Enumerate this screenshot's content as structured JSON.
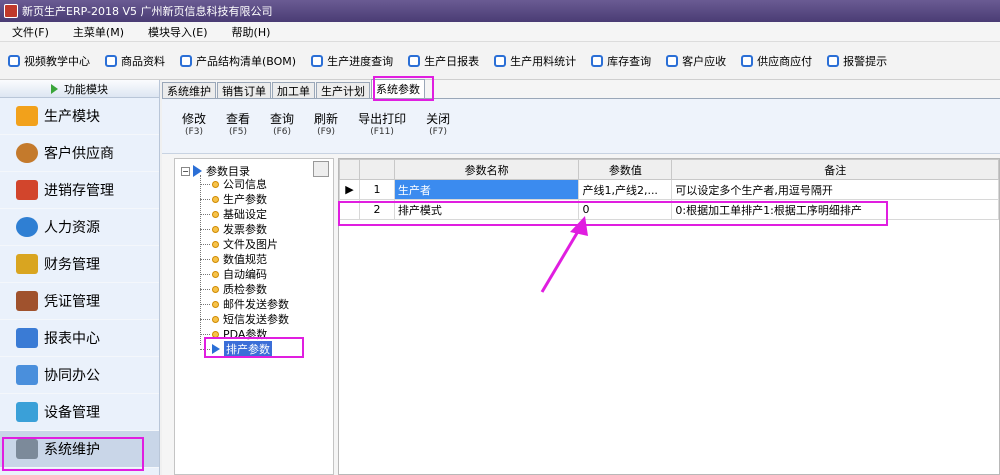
{
  "window": {
    "title": "新页生产ERP-2018 V5 广州新页信息科技有限公司"
  },
  "menu": [
    "文件(F)",
    "主菜单(M)",
    "模块导入(E)",
    "帮助(H)"
  ],
  "quickbar": [
    "视频教学中心",
    "商品资料",
    "产品结构清单(BOM)",
    "生产进度查询",
    "生产日报表",
    "生产用料统计",
    "库存查询",
    "客户应收",
    "供应商应付",
    "报警提示"
  ],
  "sidebar": {
    "header": "功能模块",
    "items": [
      {
        "label": "生产模块",
        "color": "#f2a11b"
      },
      {
        "label": "客户供应商",
        "color": "#c47a2c"
      },
      {
        "label": "进销存管理",
        "color": "#d2452c"
      },
      {
        "label": "人力资源",
        "color": "#2f7fd3"
      },
      {
        "label": "财务管理",
        "color": "#d9a520"
      },
      {
        "label": "凭证管理",
        "color": "#a0522d"
      },
      {
        "label": "报表中心",
        "color": "#3a7bd5"
      },
      {
        "label": "协同办公",
        "color": "#4a8fdc"
      },
      {
        "label": "设备管理",
        "color": "#3aa0d8"
      },
      {
        "label": "系统维护",
        "color": "#7c8a9a"
      }
    ]
  },
  "tabs": [
    "系统维护",
    "销售订单",
    "加工单",
    "生产计划",
    "系统参数"
  ],
  "toolbar": [
    {
      "label": "修改",
      "key": "(F3)"
    },
    {
      "label": "查看",
      "key": "(F5)"
    },
    {
      "label": "查询",
      "key": "(F6)"
    },
    {
      "label": "刷新",
      "key": "(F9)"
    },
    {
      "label": "导出打印",
      "key": "(F11)"
    },
    {
      "label": "关闭",
      "key": "(F7)"
    }
  ],
  "tree": {
    "root": "参数目录",
    "expander": "−",
    "nodes": [
      "公司信息",
      "生产参数",
      "基础设定",
      "发票参数",
      "文件及图片",
      "数值规范",
      "自动编码",
      "质检参数",
      "邮件发送参数",
      "短信发送参数",
      "PDA参数",
      "排产参数"
    ]
  },
  "grid": {
    "columns": [
      "参数名称",
      "参数值",
      "备注"
    ],
    "rows": [
      {
        "marker": "▶",
        "index": "1",
        "name": "生产者",
        "value": "产线1,产线2,...",
        "note": "可以设定多个生产者,用逗号隔开"
      },
      {
        "marker": "",
        "index": "2",
        "name": "排产模式",
        "value": "0",
        "note": "0:根据加工单排产1:根据工序明细排产"
      }
    ]
  },
  "colors": {
    "highlight": "#e01ee0",
    "selection": "#3b8bef"
  }
}
